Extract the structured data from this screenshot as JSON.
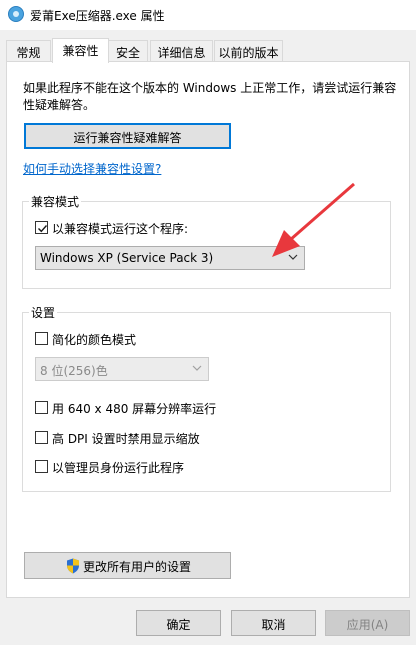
{
  "window": {
    "title": "爱莆Exe压缩器.exe 属性"
  },
  "tabs": [
    {
      "label": "常规"
    },
    {
      "label": "兼容性"
    },
    {
      "label": "安全"
    },
    {
      "label": "详细信息"
    },
    {
      "label": "以前的版本"
    }
  ],
  "compat": {
    "intro": "如果此程序不能在这个版本的 Windows 上正常工作，请尝试运行兼容性疑难解答。",
    "troubleshoot_button": "运行兼容性疑难解答",
    "manual_link": "如何手动选择兼容性设置?",
    "mode_group": {
      "title": "兼容模式",
      "checkbox_label": "以兼容模式运行这个程序:",
      "checkbox_checked": true,
      "os_selected": "Windows XP (Service Pack 3)"
    },
    "settings_group": {
      "title": "设置",
      "reduced_color": {
        "label": "简化的颜色模式",
        "checked": false
      },
      "color_select": "8 位(256)色",
      "run_640": {
        "label": "用 640 x 480 屏幕分辨率运行",
        "checked": false
      },
      "high_dpi": {
        "label": "高 DPI 设置时禁用显示缩放",
        "checked": false
      },
      "run_admin": {
        "label": "以管理员身份运行此程序",
        "checked": false
      }
    },
    "change_all_button": "更改所有用户的设置"
  },
  "footer": {
    "ok": "确定",
    "cancel": "取消",
    "apply": "应用(A)"
  },
  "annotation": {
    "arrow_color": "#e8383d"
  },
  "colors": {
    "link": "#0066cc",
    "focus": "#0078d7",
    "panel_bg": "#ffffff",
    "window_bg": "#f0f0f0"
  }
}
